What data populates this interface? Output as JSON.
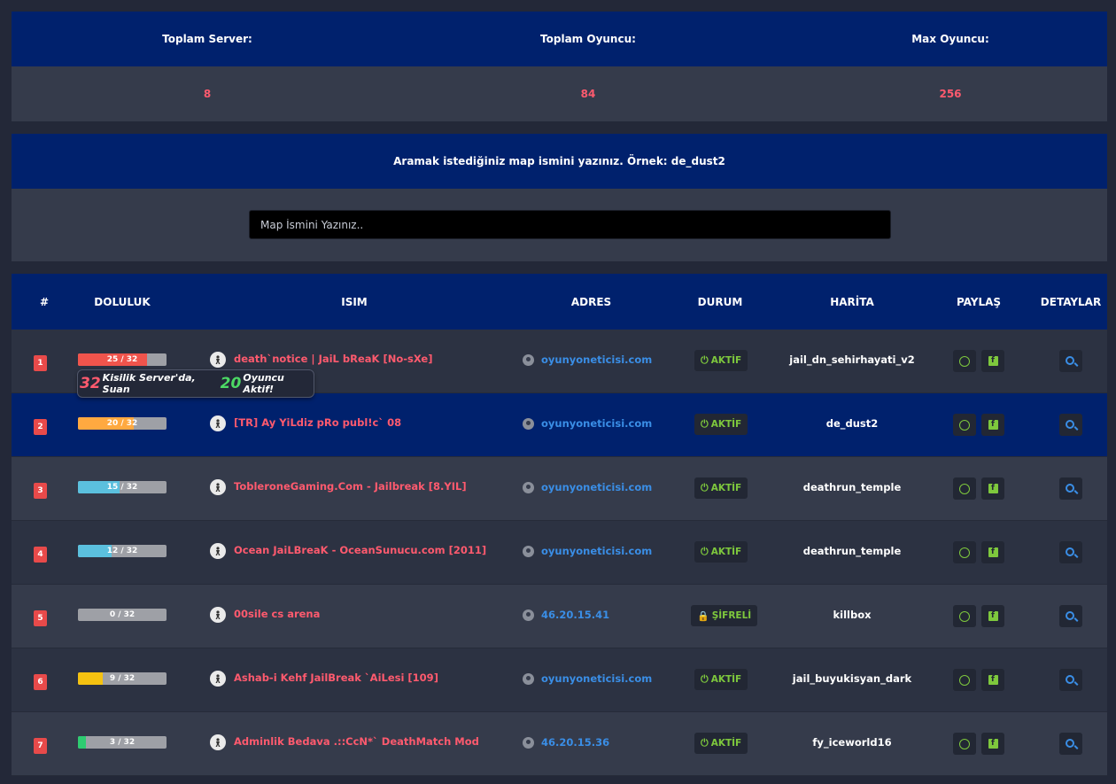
{
  "stats": {
    "headers": [
      "Toplam Server:",
      "Toplam Oyuncu:",
      "Max Oyuncu:"
    ],
    "values": [
      "8",
      "84",
      "256"
    ]
  },
  "search": {
    "label": "Aramak istediğiniz map ismini yazınız. Örnek: de_dust2",
    "placeholder": "Map İsmini Yazınız.."
  },
  "table": {
    "headers": [
      "#",
      "DOLULUK",
      "ISIM",
      "ADRES",
      "DURUM",
      "HARİTA",
      "PAYLAŞ",
      "DETAYLAR"
    ]
  },
  "servers": [
    {
      "rank": "1",
      "players": "25 / 32",
      "fill": 0.78,
      "fill_color": "#f0544c",
      "name": "death`notice | JaiL bReaK [No-sXe]",
      "address": "oyunyoneticisi.com",
      "status": "AKTİF",
      "map": "jail_dn_sehirhayati_v2"
    },
    {
      "rank": "2",
      "players": "20 / 32",
      "fill": 0.625,
      "fill_color": "#ffa940",
      "name": "[TR] Ay YiLdiz pRo publ!c` 08",
      "address": "oyunyoneticisi.com",
      "status": "AKTİF",
      "map": "de_dust2"
    },
    {
      "rank": "3",
      "players": "15 / 32",
      "fill": 0.47,
      "fill_color": "#5bc0de",
      "name": "TobleroneGaming.Com - Jailbreak [8.YIL]",
      "address": "oyunyoneticisi.com",
      "status": "AKTİF",
      "map": "deathrun_temple"
    },
    {
      "rank": "4",
      "players": "12 / 32",
      "fill": 0.375,
      "fill_color": "#5bc0de",
      "name": "Ocean JaiLBreaK - OceanSunucu.com [2011]",
      "address": "oyunyoneticisi.com",
      "status": "AKTİF",
      "map": "deathrun_temple"
    },
    {
      "rank": "5",
      "players": "0 / 32",
      "fill": 0,
      "fill_color": "#5bc0de",
      "name": "00sile cs arena",
      "address": "46.20.15.41",
      "status": "ŞİFRELİ",
      "map": "killbox"
    },
    {
      "rank": "6",
      "players": "9 / 32",
      "fill": 0.28,
      "fill_color": "#f5c211",
      "name": "Ashab-i Kehf JailBreak `AiLesi [109]",
      "address": "oyunyoneticisi.com",
      "status": "AKTİF",
      "map": "jail_buyukisyan_dark"
    },
    {
      "rank": "7",
      "players": "3 / 32",
      "fill": 0.094,
      "fill_color": "#2ecc71",
      "name": "Adminlik Bedava .::CcN*` DeathMatch Mod",
      "address": "46.20.15.36",
      "status": "AKTİF",
      "map": "fy_iceworld16"
    }
  ],
  "tooltip": {
    "max": "32",
    "text1": "Kisilik Server'da, Suan",
    "current": "20",
    "text2": "Oyuncu Aktif!"
  },
  "colors": {
    "header_blue": "#00216d",
    "accent_red": "#ff5a6e",
    "link_blue": "#3a8ee6",
    "status_green": "#7ec83d"
  }
}
